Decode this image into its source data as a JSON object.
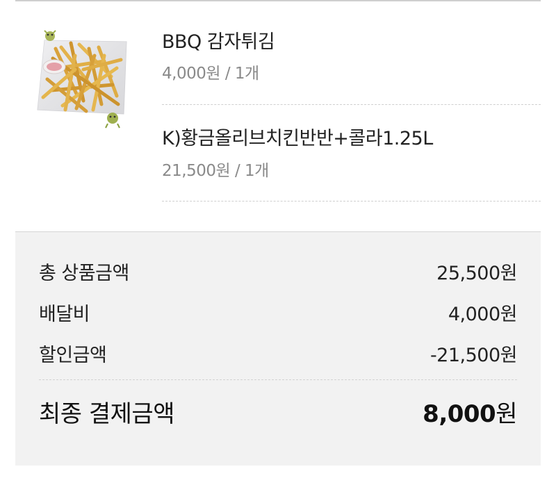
{
  "items": [
    {
      "name": "BBQ 감자튀김",
      "price": "4,000원 / 1개"
    },
    {
      "name": "K)황금올리브치킨반반+콜라1.25L",
      "price": "21,500원 / 1개"
    }
  ],
  "summary": {
    "rows": [
      {
        "label": "총 상품금액",
        "value": "25,500원"
      },
      {
        "label": "배달비",
        "value": "4,000원"
      },
      {
        "label": "할인금액",
        "value": "-21,500원"
      }
    ],
    "final": {
      "label": "최종 결제금액",
      "amount": "8,000",
      "currency": "원"
    }
  },
  "icons": {
    "product_image": "french-fries-photo"
  },
  "colors": {
    "summary_background": "#f2f2f2",
    "price_gray": "#8a8a8a",
    "text": "#222222"
  }
}
